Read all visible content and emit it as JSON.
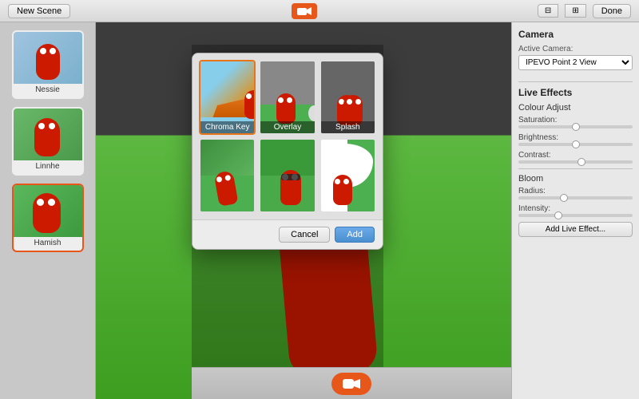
{
  "topbar": {
    "new_scene": "New Scene",
    "done": "Done",
    "segment_left": "▪",
    "segment_right": "▪"
  },
  "sidebar": {
    "scenes": [
      {
        "label": "Nessie",
        "active": false
      },
      {
        "label": "Linnhe",
        "active": false
      },
      {
        "label": "Hamish",
        "active": true
      }
    ]
  },
  "modal": {
    "effects": [
      {
        "label": "Chroma Key",
        "selected": true
      },
      {
        "label": "Overlay",
        "selected": false
      },
      {
        "label": "Splash",
        "selected": false
      },
      {
        "label": "",
        "selected": false
      },
      {
        "label": "",
        "selected": false
      },
      {
        "label": "",
        "selected": false
      }
    ],
    "cancel_btn": "Cancel",
    "add_btn": "Add"
  },
  "right_panel": {
    "camera_title": "Camera",
    "active_camera_label": "Active Camera:",
    "active_camera_value": "IPEVO Point 2 View",
    "live_effects_title": "Live Effects",
    "colour_adjust_title": "Colour Adjust",
    "saturation_label": "Saturation:",
    "brightness_label": "Brightness:",
    "contrast_label": "Contrast:",
    "bloom_title": "Bloom",
    "radius_label": "Radius:",
    "intensity_label": "Intensity:",
    "add_effect_btn": "Add Live Effect..."
  },
  "bottom_bar": {
    "camera_icon": "📷"
  }
}
